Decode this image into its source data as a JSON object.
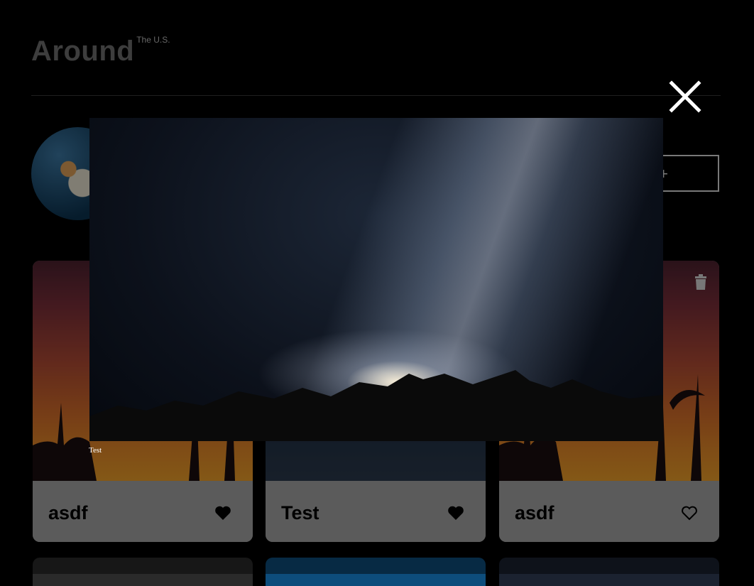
{
  "header": {
    "logo_main": "Around",
    "logo_sup": "The U.S."
  },
  "profile": {
    "add_button_symbol": "+"
  },
  "cards": [
    {
      "title": "asdf",
      "liked": true
    },
    {
      "title": "Test",
      "liked": true
    },
    {
      "title": "asdf",
      "liked": false
    }
  ],
  "popup": {
    "caption": "Test",
    "close_icon": "close-icon"
  },
  "colors": {
    "background": "#000000",
    "card_footer": "#a6a6a6",
    "logo": "#6f6f6f"
  }
}
